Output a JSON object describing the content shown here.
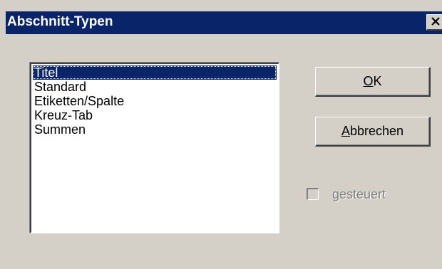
{
  "window": {
    "title": "Abschnitt-Typen",
    "close_icon": "close-icon"
  },
  "section_list": {
    "selected_index": 0,
    "items": [
      {
        "label": "Titel",
        "selected": true
      },
      {
        "label": "Standard",
        "selected": false
      },
      {
        "label": "Etiketten/Spalte",
        "selected": false
      },
      {
        "label": "Kreuz-Tab",
        "selected": false
      },
      {
        "label": "Summen",
        "selected": false
      }
    ]
  },
  "buttons": {
    "ok": {
      "mnemonic": "O",
      "rest": "K"
    },
    "cancel": {
      "mnemonic": "A",
      "rest": "bbrechen"
    }
  },
  "controlled_checkbox": {
    "label": "gesteuert",
    "checked": false,
    "enabled": false
  },
  "colors": {
    "titlebar": "#0a246a",
    "dialog_face": "#d4d0c8",
    "selection": "#0a246a",
    "disabled_text": "#808080"
  }
}
